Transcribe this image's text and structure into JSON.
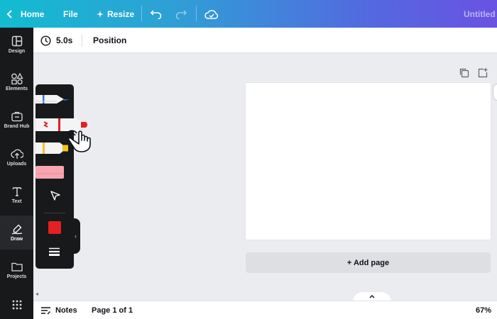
{
  "topbar": {
    "home_label": "Home",
    "file_label": "File",
    "resize_label": "Resize",
    "title": "Untitled d",
    "icons": [
      "chevron-left-icon",
      "sparkle-icon",
      "undo-icon",
      "redo-icon",
      "cloud-check-icon"
    ]
  },
  "rail": {
    "items": [
      {
        "label": "Design",
        "icon": "layout-icon"
      },
      {
        "label": "Elements",
        "icon": "shapes-icon"
      },
      {
        "label": "Brand Hub",
        "icon": "briefcase-icon"
      },
      {
        "label": "Uploads",
        "icon": "upload-cloud-icon"
      },
      {
        "label": "Text",
        "icon": "text-t-icon"
      },
      {
        "label": "Draw",
        "icon": "draw-icon",
        "active": true
      },
      {
        "label": "Projects",
        "icon": "folder-icon"
      },
      {
        "label": "",
        "icon": "apps-grid-icon"
      }
    ]
  },
  "context_toolbar": {
    "duration": "5.0s",
    "position_label": "Position"
  },
  "canvas": {
    "add_page_label": "+ Add page"
  },
  "draw_panel": {
    "tools": [
      "pen",
      "marker",
      "highlighter",
      "eraser",
      "select"
    ],
    "active_tool": "marker",
    "current_color": "#e42020"
  },
  "footer": {
    "notes_label": "Notes",
    "page_indicator": "Page 1 of 1",
    "zoom": "67%"
  },
  "colors": {
    "accent_gradient_start": "#12bcd0",
    "accent_gradient_end": "#6a52e3",
    "rail_bg": "#18191b",
    "canvas_bg": "#ebecf0"
  }
}
